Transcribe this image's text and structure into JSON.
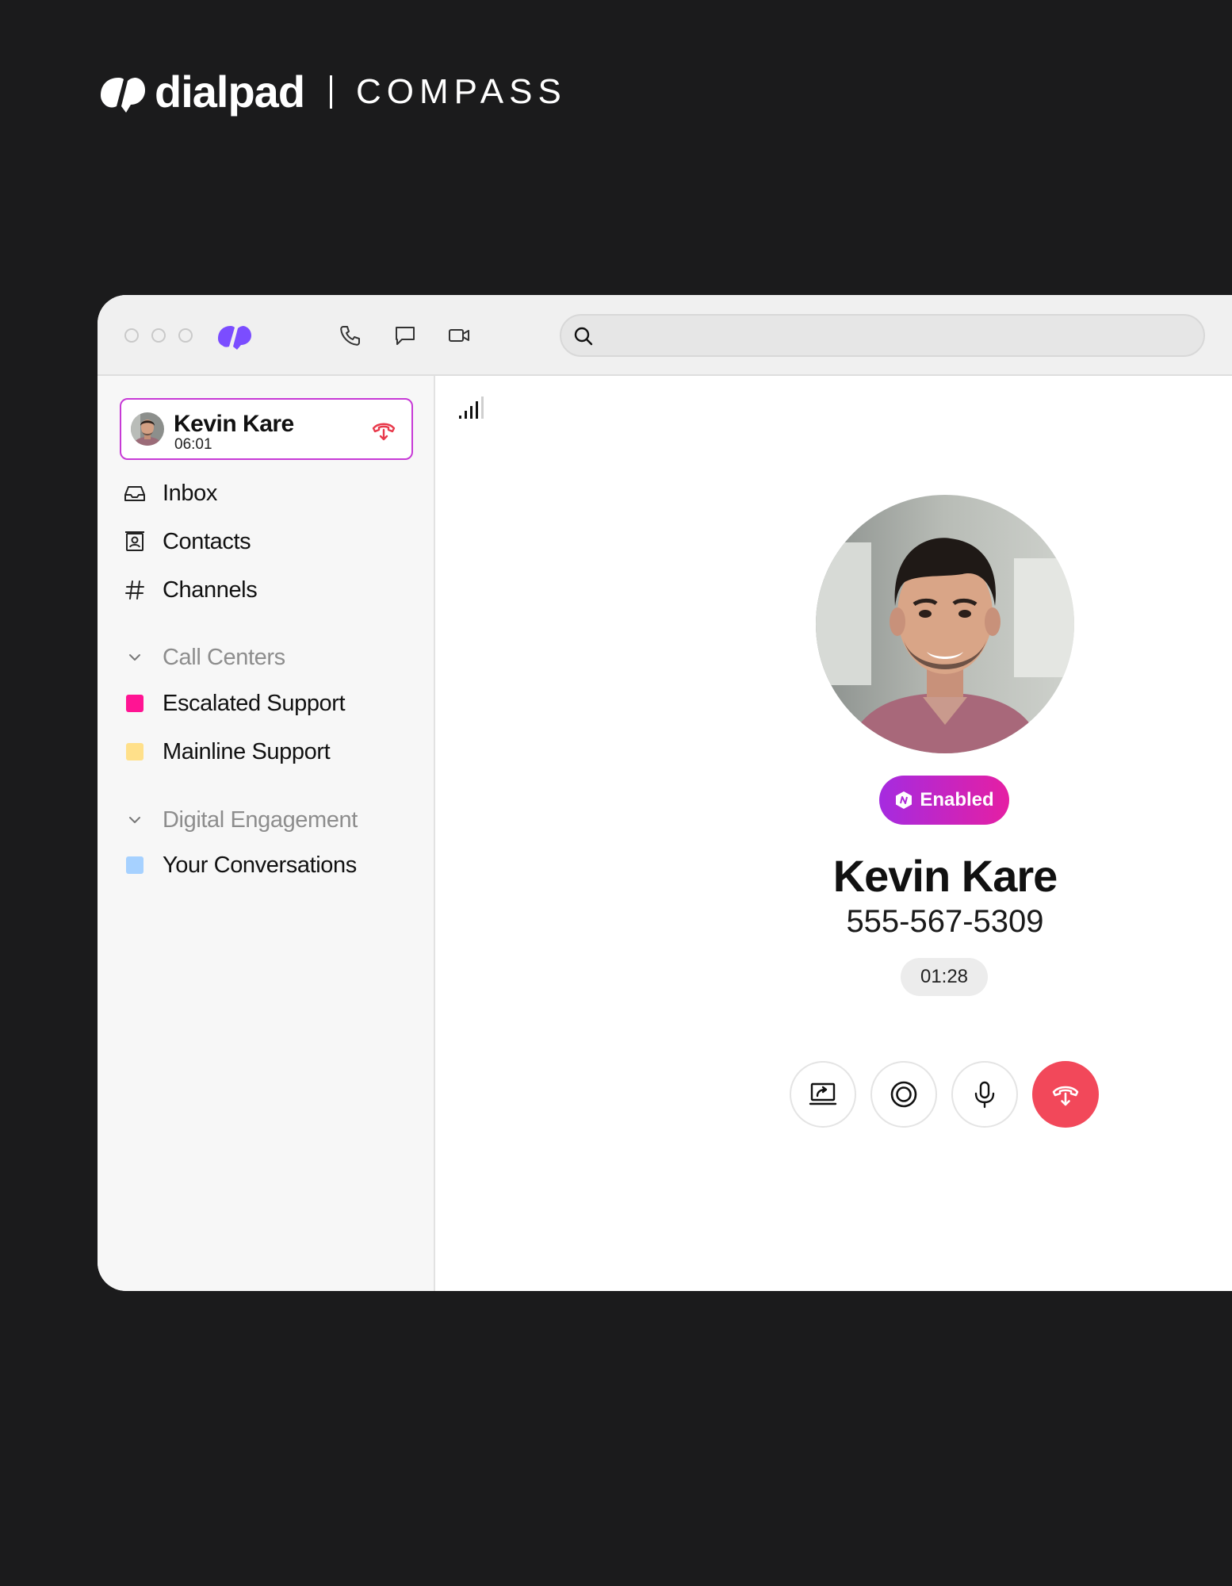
{
  "brand": {
    "wordmark": "dialpad",
    "product": "COMPASS"
  },
  "titlebar": {
    "search_placeholder": ""
  },
  "active_call": {
    "name": "Kevin Kare",
    "duration": "06:01"
  },
  "sidebar": {
    "items": [
      {
        "label": "Inbox",
        "icon": "inbox-icon"
      },
      {
        "label": "Contacts",
        "icon": "contacts-icon"
      },
      {
        "label": "Channels",
        "icon": "hash-icon"
      }
    ],
    "call_centers": {
      "label": "Call Centers",
      "items": [
        {
          "label": "Escalated Support",
          "color": "#ff1493"
        },
        {
          "label": "Mainline Support",
          "color": "#ffe08a"
        }
      ]
    },
    "digital_engagement": {
      "label": "Digital Engagement",
      "items": [
        {
          "label": "Your Conversations",
          "color": "#a6d1ff"
        }
      ]
    }
  },
  "call": {
    "badge": "Enabled",
    "name": "Kevin Kare",
    "number": "555-567-5309",
    "timer": "01:28"
  },
  "colors": {
    "accent_purple": "#7b4dff",
    "active_border": "#c73ad6",
    "hangup_red": "#f2485a",
    "badge_gradient_start": "#a52be0",
    "badge_gradient_end": "#e51fa3"
  }
}
